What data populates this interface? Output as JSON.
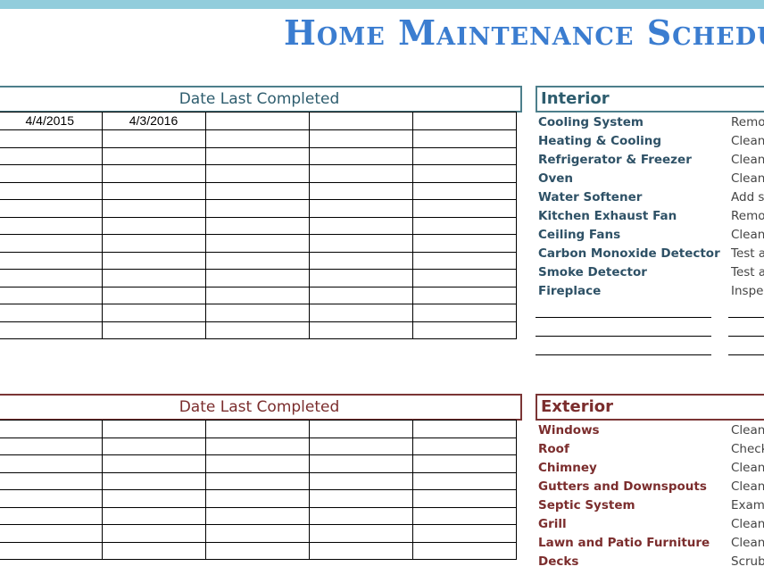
{
  "title": "Home Maintenance Schedule",
  "colors": {
    "top_band": "#92cddc",
    "title": "#3b7dd0",
    "interior_accent": "#4d7f8b",
    "exterior_accent": "#7b3535"
  },
  "interior": {
    "date_header": "Date Last Completed",
    "category_header": "Interior",
    "dates": [
      [
        "4/4/2015",
        "4/3/2016",
        "",
        "",
        ""
      ],
      [
        "",
        "",
        "",
        "",
        ""
      ],
      [
        "",
        "",
        "",
        "",
        ""
      ],
      [
        "",
        "",
        "",
        "",
        ""
      ],
      [
        "",
        "",
        "",
        "",
        ""
      ],
      [
        "",
        "",
        "",
        "",
        ""
      ],
      [
        "",
        "",
        "",
        "",
        ""
      ],
      [
        "",
        "",
        "",
        "",
        ""
      ],
      [
        "",
        "",
        "",
        "",
        ""
      ],
      [
        "",
        "",
        "",
        "",
        ""
      ],
      [
        "",
        "",
        "",
        "",
        ""
      ],
      [
        "",
        "",
        "",
        "",
        ""
      ],
      [
        "",
        "",
        "",
        "",
        ""
      ]
    ],
    "items": [
      {
        "name": "Cooling System",
        "desc": "Remo"
      },
      {
        "name": "Heating & Cooling",
        "desc": "Clean"
      },
      {
        "name": "Refrigerator & Freezer",
        "desc": "Clean"
      },
      {
        "name": "Oven",
        "desc": "Clean"
      },
      {
        "name": "Water Softener",
        "desc": "Add s"
      },
      {
        "name": "Kitchen Exhaust Fan",
        "desc": "Remo"
      },
      {
        "name": "Ceiling Fans",
        "desc": "Clean"
      },
      {
        "name": "Carbon Monoxide Detector",
        "desc": "Test a"
      },
      {
        "name": "Smoke Detector",
        "desc": "Test a"
      },
      {
        "name": "Fireplace",
        "desc": "Inspe"
      }
    ]
  },
  "exterior": {
    "date_header": "Date Last Completed",
    "category_header": "Exterior",
    "items": [
      {
        "name": "Windows",
        "desc": "Clean"
      },
      {
        "name": "Roof",
        "desc": "Check"
      },
      {
        "name": "Chimney",
        "desc": "Clean"
      },
      {
        "name": "Gutters and Downspouts",
        "desc": "Clean"
      },
      {
        "name": "Septic System",
        "desc": "Exami"
      },
      {
        "name": "Grill",
        "desc": "Clean"
      },
      {
        "name": "Lawn and Patio Furniture",
        "desc": "Clean"
      },
      {
        "name": "Decks",
        "desc": "Scrub"
      }
    ]
  }
}
